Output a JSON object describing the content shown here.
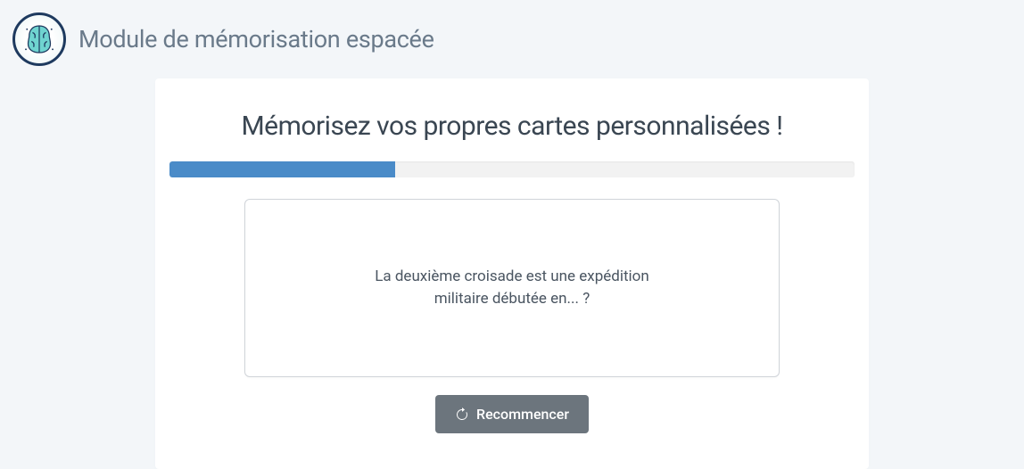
{
  "header": {
    "title": "Module de mémorisation espacée"
  },
  "main": {
    "title": "Mémorisez vos propres cartes personnalisées !",
    "progress_percent": 33,
    "card_text": "La deuxième croisade est une expédition militaire débutée en... ?",
    "restart_label": "Recommencer"
  },
  "colors": {
    "accent": "#4a8bc8",
    "button": "#6c757d",
    "bg": "#f3f6f9"
  }
}
